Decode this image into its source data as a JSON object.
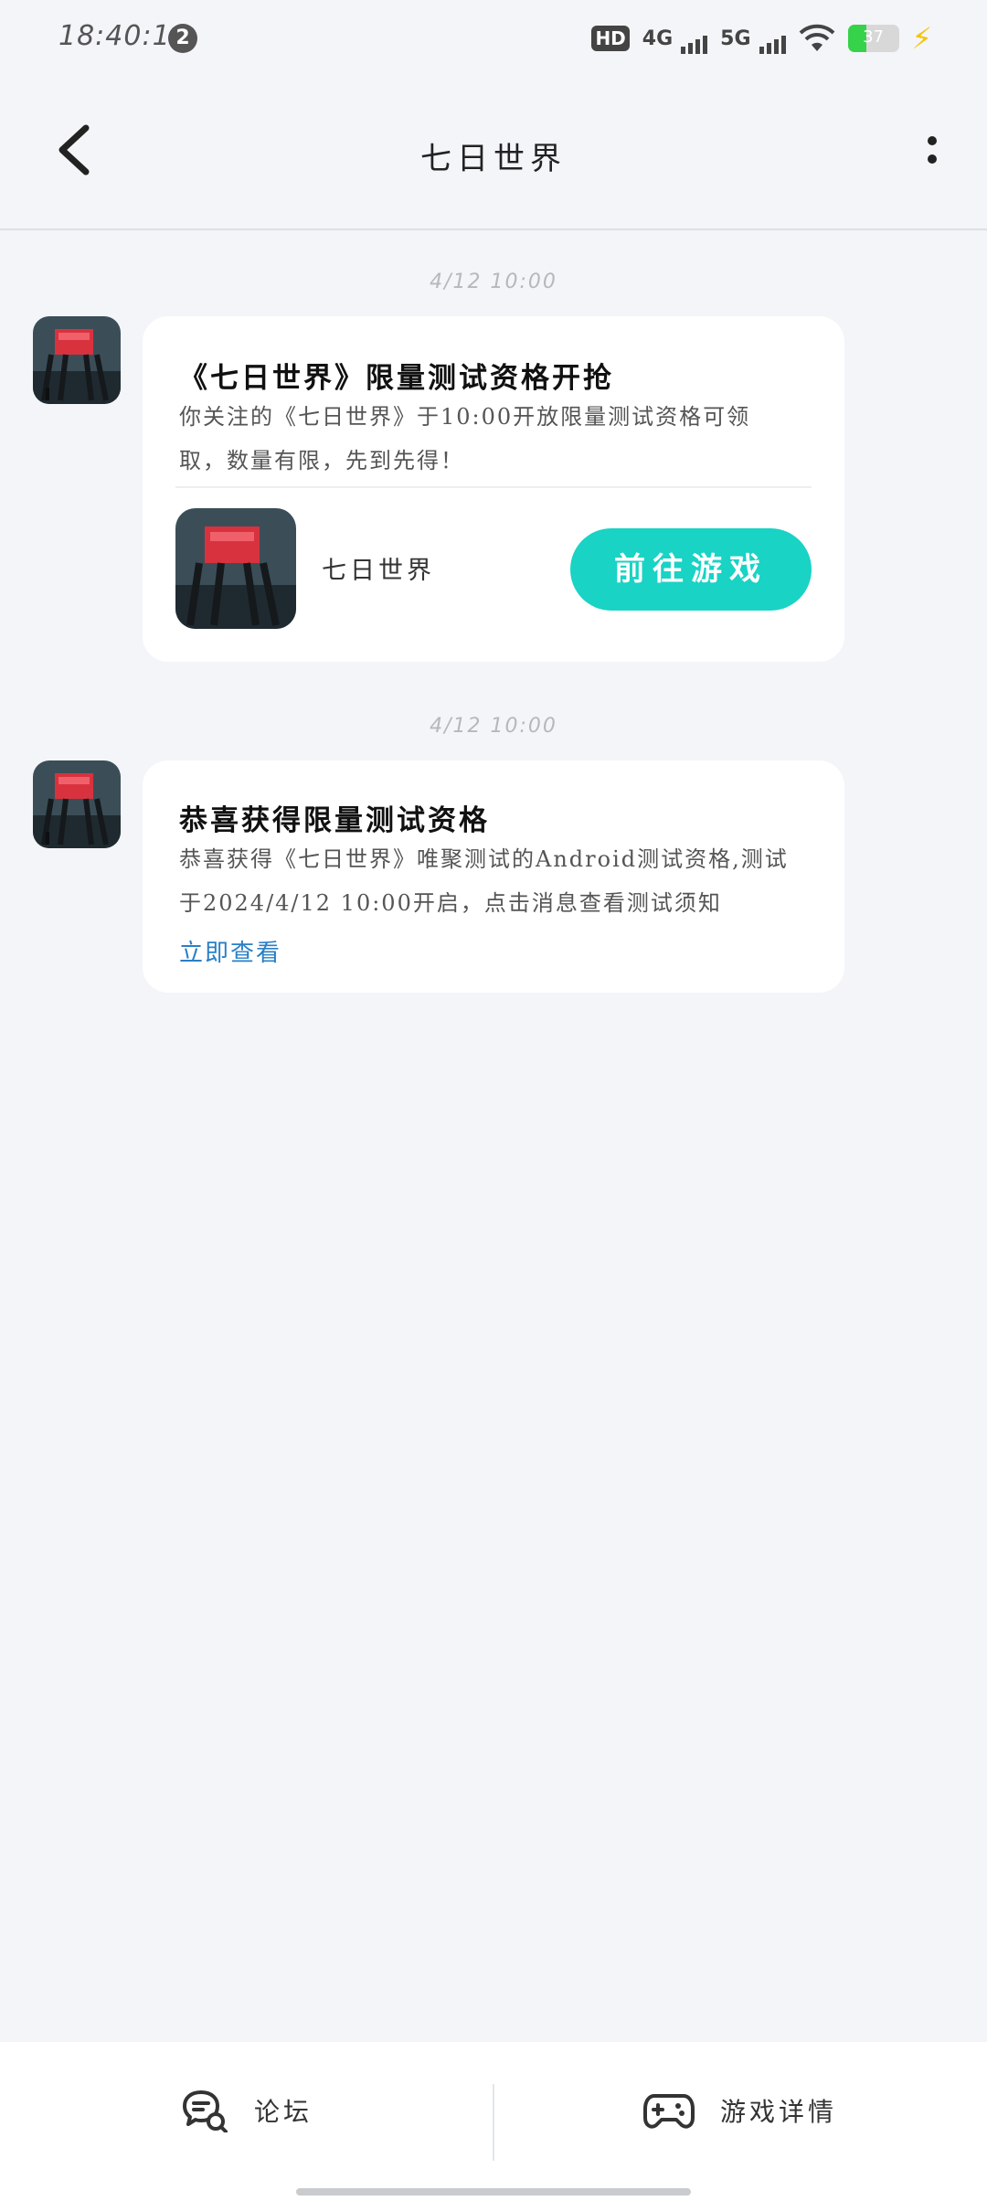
{
  "status_bar": {
    "time": "18:40:14",
    "notification_count": "2",
    "hd_label": "HD",
    "net1": "4G",
    "net2": "5G",
    "battery": "37"
  },
  "header": {
    "title": "七日世界"
  },
  "messages": [
    {
      "timestamp": "4/12 10:00",
      "title": "《七日世界》限量测试资格开抢",
      "body": "你关注的《七日世界》于10:00开放限量测试资格可领取，数量有限，先到先得！",
      "game_name": "七日世界",
      "action_label": "前往游戏"
    },
    {
      "timestamp": "4/12 10:00",
      "title": "恭喜获得限量测试资格",
      "body": "恭喜获得《七日世界》唯聚测试的Android测试资格,测试于2024/4/12 10:00开启，点击消息查看测试须知",
      "link_label": "立即查看"
    }
  ],
  "bottom_nav": {
    "forum_label": "论坛",
    "details_label": "游戏详情"
  },
  "colors": {
    "accent": "#19d3c5",
    "link": "#2a7fc5",
    "background": "#f3f5f8"
  }
}
